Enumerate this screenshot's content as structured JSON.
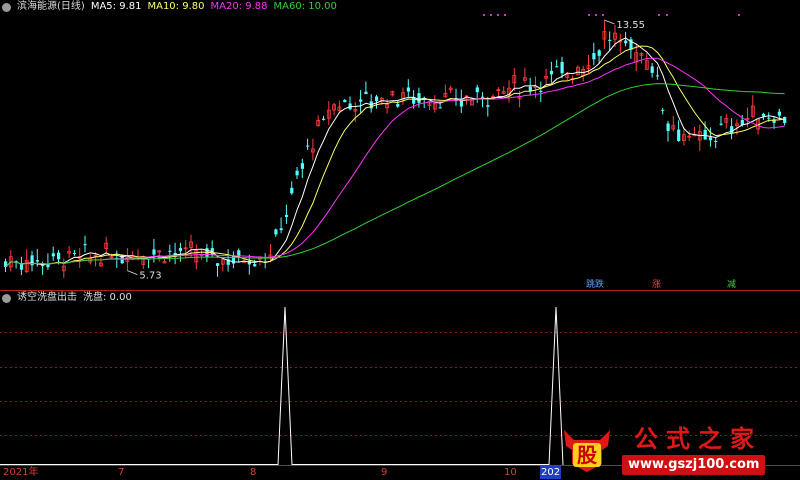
{
  "legend": {
    "title": "滨海能源(日线)",
    "ma5": "MA5: 9.81",
    "ma10": "MA10: 9.80",
    "ma20": "MA20: 9.88",
    "ma60": "MA60: 10.00"
  },
  "indicator": {
    "title": "诱空洗盘出击",
    "value": "洗盘: 0.00"
  },
  "signals": [
    {
      "text": "跳跌",
      "color": "#5aa0ff"
    },
    {
      "text": "涨",
      "color": "#ff4444"
    },
    {
      "text": "减",
      "color": "#46c846"
    }
  ],
  "axis": {
    "labels": [
      {
        "text": "2021年"
      },
      {
        "text": "7"
      },
      {
        "text": "8"
      },
      {
        "text": "9"
      },
      {
        "text": "10"
      },
      {
        "text": "202"
      }
    ]
  },
  "annotations": {
    "high": "13.55",
    "low": "5.73"
  },
  "logo": {
    "title": "公式之家",
    "url": "www.gszj100.com",
    "badge": "股"
  },
  "colors": {
    "up": "#ff3c3c",
    "down": "#54ffff",
    "ma5": "#ffffff",
    "ma10": "#ffff64",
    "ma20": "#ff32ff",
    "ma60": "#32d232",
    "grid": "#8b1a1a",
    "divider": "#b02020"
  },
  "icons": [
    "settings-icon",
    "logo-badge-icon"
  ]
}
